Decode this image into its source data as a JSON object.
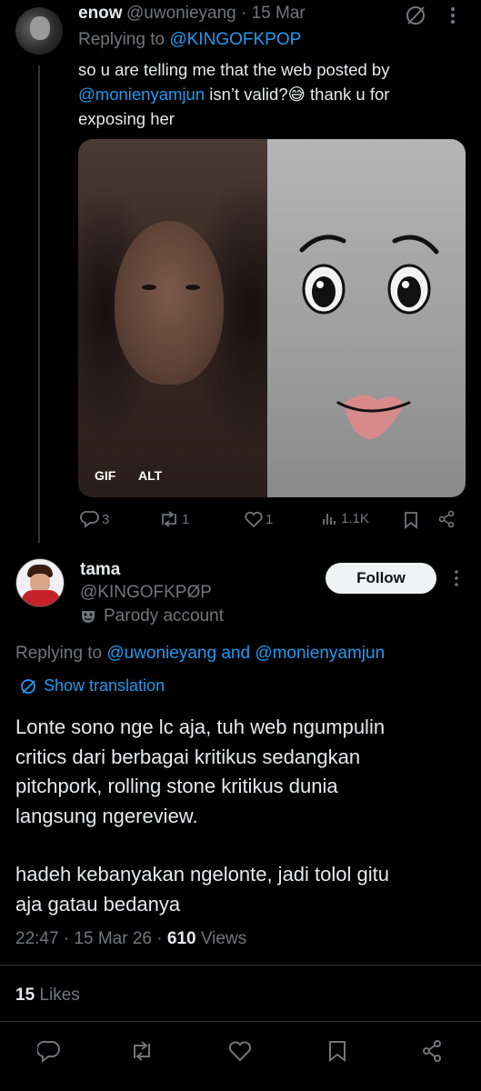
{
  "reply_tweet": {
    "author_name": "enow",
    "handle_date": "@uwonieyang · 15 Mar",
    "replying_prefix": "Replying to ",
    "replying_to": "@KINGOFKPOP",
    "text_line1": "so u are telling me that the web posted by",
    "mention": "@monienyamjun",
    "text_line2_rest": " isn’t valid?😅 thank u for",
    "text_line3": "exposing her",
    "media_badges": [
      "GIF",
      "ALT"
    ],
    "actions": {
      "replies": "3",
      "retweets": "1",
      "likes": "1",
      "views": "1.1K"
    },
    "icons": [
      "verified-slash-icon",
      "more-icon",
      "reply-icon",
      "retweet-icon",
      "like-icon",
      "views-icon",
      "bookmark-icon",
      "share-icon"
    ]
  },
  "main_tweet": {
    "author_name": "tama",
    "handle": "@KINGOFKPØP",
    "parody_label": "Parody account",
    "follow_label": "Follow",
    "replying_prefix": "Replying to ",
    "replying_to_1": "@uwonieyang",
    "replying_and": " and ",
    "replying_to_2": "@monienyamjun",
    "show_translation": "Show translation",
    "text_paragraph1": [
      "Lonte sono nge lc aja, tuh web ngumpulin",
      "critics dari berbagai kritikus sedangkan",
      "pitchpork, rolling stone kritikus dunia",
      "langsung ngereview."
    ],
    "text_paragraph2": [
      "hadeh kebanyakan ngelonte, jadi tolol gitu",
      "aja gatau bedanya"
    ],
    "timestamp": "22:47 · 15 Mar 26 · ",
    "views_count": "610",
    "views_label": " Views",
    "likes_count": "15",
    "likes_label": " Likes"
  },
  "colors": {
    "background": "#000000",
    "text": "#e7e9ea",
    "muted": "#71767b",
    "link": "#1d9bf0",
    "divider": "#2f3336"
  }
}
